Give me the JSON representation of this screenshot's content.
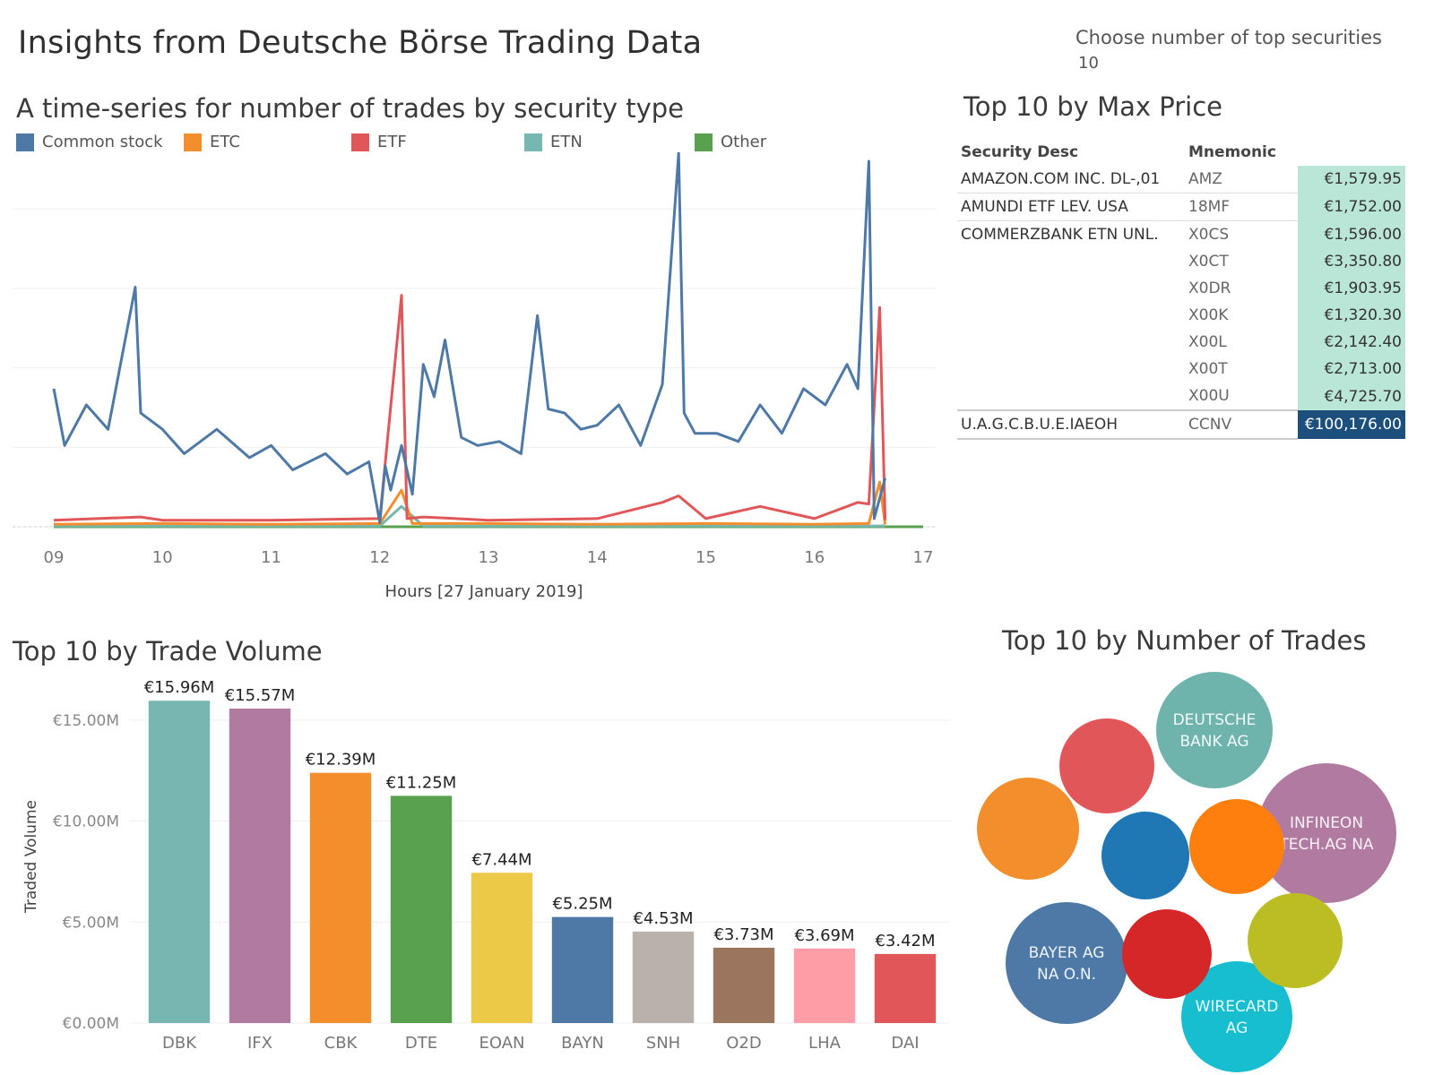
{
  "dashboard": {
    "title": "Insights from Deutsche Börse Trading Data",
    "parameter_label": "Choose number of top securities",
    "parameter_value": "10"
  },
  "chart_data": [
    {
      "id": "trades-timeseries",
      "type": "line",
      "title": "A time-series for number of trades by security type",
      "xlabel": "Hours [27 January 2019]",
      "ylabel": "",
      "x_ticks": [
        "09",
        "10",
        "11",
        "12",
        "13",
        "14",
        "15",
        "16",
        "17"
      ],
      "xlim": [
        9,
        17
      ],
      "ylim": [
        0,
        450
      ],
      "grid": true,
      "legend_position": "top",
      "series": [
        {
          "name": "Common stock",
          "color": "#4e79a7",
          "x": [
            9.0,
            9.1,
            9.3,
            9.5,
            9.75,
            9.8,
            10.0,
            10.2,
            10.5,
            10.8,
            11.0,
            11.2,
            11.5,
            11.7,
            11.9,
            12.0,
            12.05,
            12.1,
            12.2,
            12.3,
            12.4,
            12.5,
            12.6,
            12.75,
            12.9,
            13.1,
            13.3,
            13.45,
            13.55,
            13.7,
            13.85,
            14.0,
            14.2,
            14.4,
            14.6,
            14.75,
            14.8,
            14.9,
            15.1,
            15.3,
            15.5,
            15.7,
            15.9,
            16.1,
            16.3,
            16.4,
            16.5,
            16.55,
            16.65
          ],
          "y": [
            170,
            100,
            150,
            120,
            295,
            140,
            120,
            90,
            120,
            85,
            100,
            70,
            90,
            65,
            80,
            5,
            75,
            45,
            100,
            40,
            200,
            160,
            230,
            110,
            100,
            105,
            90,
            260,
            145,
            140,
            120,
            125,
            150,
            100,
            175,
            460,
            140,
            115,
            115,
            105,
            150,
            115,
            170,
            150,
            200,
            170,
            450,
            10,
            60
          ]
        },
        {
          "name": "ETC",
          "color": "#f28e2b",
          "x": [
            9.0,
            10.0,
            11.0,
            12.0,
            12.2,
            12.3,
            13.0,
            14.0,
            15.0,
            16.0,
            16.5,
            16.6,
            16.65
          ],
          "y": [
            3,
            4,
            3,
            4,
            45,
            4,
            4,
            3,
            4,
            3,
            4,
            55,
            3
          ]
        },
        {
          "name": "ETF",
          "color": "#e15759",
          "x": [
            9.0,
            9.8,
            10.0,
            11.0,
            12.0,
            12.2,
            12.25,
            12.4,
            13.0,
            14.0,
            14.6,
            14.75,
            15.0,
            15.5,
            16.0,
            16.4,
            16.5,
            16.6,
            16.65
          ],
          "y": [
            8,
            12,
            8,
            8,
            10,
            285,
            10,
            12,
            8,
            10,
            30,
            38,
            10,
            25,
            10,
            30,
            28,
            270,
            8
          ]
        },
        {
          "name": "ETN",
          "color": "#76b7b2",
          "x": [
            9.0,
            12.0,
            12.2,
            12.4,
            13.0,
            16.0,
            16.65
          ],
          "y": [
            1,
            1,
            25,
            1,
            1,
            1,
            1
          ]
        },
        {
          "name": "Other",
          "color": "#59a14f",
          "x": [
            9.0,
            17.0
          ],
          "y": [
            0,
            0
          ]
        }
      ]
    },
    {
      "id": "trade-volume",
      "type": "bar",
      "title": "Top 10 by Trade Volume",
      "xlabel": "",
      "ylabel": "Traded Volume",
      "categories": [
        "DBK",
        "IFX",
        "CBK",
        "DTE",
        "EOAN",
        "BAYN",
        "SNH",
        "O2D",
        "LHA",
        "DAI"
      ],
      "values": [
        15.96,
        15.57,
        12.39,
        11.25,
        7.44,
        5.25,
        4.53,
        3.73,
        3.69,
        3.42
      ],
      "value_labels": [
        "€15.96M",
        "€15.57M",
        "€12.39M",
        "€11.25M",
        "€7.44M",
        "€5.25M",
        "€4.53M",
        "€3.73M",
        "€3.69M",
        "€3.42M"
      ],
      "colors": [
        "#76b7b2",
        "#b07aa1",
        "#f28e2b",
        "#59a14f",
        "#edc948",
        "#4e79a7",
        "#bab0ac",
        "#9c755f",
        "#ff9da7",
        "#e15759"
      ],
      "y_ticks": [
        0,
        5,
        10,
        15
      ],
      "y_tick_labels": [
        "€0.00M",
        "€5.00M",
        "€10.00M",
        "€15.00M"
      ],
      "ylim": [
        0,
        16.5
      ],
      "grid": true
    },
    {
      "id": "number-of-trades",
      "type": "scatter",
      "subtype": "packed-bubbles",
      "title": "Top 10 by Number of Trades",
      "bubbles": [
        {
          "label": "DEUTSCHE BANK AG",
          "color": "#6fb3ad"
        },
        {
          "label": "INFINEON TECH.AG NA",
          "color": "#b07aa1"
        },
        {
          "label": "BAYER AG NA O.N.",
          "color": "#4e79a7"
        },
        {
          "label": "WIRECARD AG",
          "color": "#17becf"
        },
        {
          "label": "",
          "color": "#e15759"
        },
        {
          "label": "",
          "color": "#f28e2b"
        },
        {
          "label": "",
          "color": "#1f77b4"
        },
        {
          "label": "",
          "color": "#ff7f0e"
        },
        {
          "label": "",
          "color": "#d62728"
        },
        {
          "label": "",
          "color": "#bcbd22"
        }
      ]
    }
  ],
  "price_table": {
    "title": "Top 10 by Max Price",
    "columns": [
      "Security Desc",
      "Mnemonic",
      ""
    ],
    "rows": [
      {
        "desc": "AMAZON.COM INC.   DL-,01",
        "mnemonic": "AMZ",
        "price": "€1,579.95"
      },
      {
        "desc": "AMUNDI ETF LEV. USA",
        "mnemonic": "18MF",
        "price": "€1,752.00"
      },
      {
        "desc": "COMMERZBANK ETN UNL.",
        "mnemonic": "X0CS",
        "price": "€1,596.00"
      },
      {
        "desc": "",
        "mnemonic": "X0CT",
        "price": "€3,350.80"
      },
      {
        "desc": "",
        "mnemonic": "X0DR",
        "price": "€1,903.95"
      },
      {
        "desc": "",
        "mnemonic": "X00K",
        "price": "€1,320.30"
      },
      {
        "desc": "",
        "mnemonic": "X00L",
        "price": "€2,142.40"
      },
      {
        "desc": "",
        "mnemonic": "X00T",
        "price": "€2,713.00"
      },
      {
        "desc": "",
        "mnemonic": "X00U",
        "price": "€4,725.70"
      },
      {
        "desc": "U.A.G.C.B.U.E.IAEOH",
        "mnemonic": "CCNV",
        "price": "€100,176.00"
      }
    ]
  }
}
